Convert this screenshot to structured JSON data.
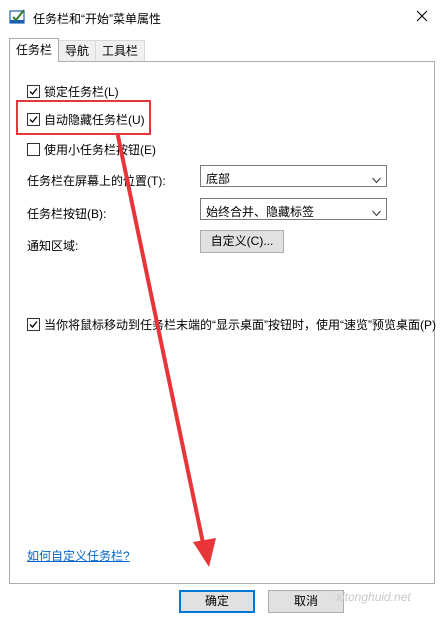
{
  "window": {
    "title": "任务栏和“开始”菜单属性"
  },
  "tabs": [
    {
      "label": "任务栏",
      "active": true
    },
    {
      "label": "导航",
      "active": false
    },
    {
      "label": "工具栏",
      "active": false
    }
  ],
  "checkboxes": {
    "lock": {
      "label": "锁定任务栏(L)",
      "checked": true
    },
    "autohide": {
      "label": "自动隐藏任务栏(U)",
      "checked": true
    },
    "small_buttons": {
      "label": "使用小任务栏按钮(E)",
      "checked": false
    },
    "peek": {
      "label": "当你将鼠标移动到任务栏末端的“显示桌面”按钮时，使用“速览”预览桌面(P)",
      "checked": true
    }
  },
  "fields": {
    "position_label": "任务栏在屏幕上的位置(T):",
    "position_value": "底部",
    "buttons_label": "任务栏按钮(B):",
    "buttons_value": "始终合并、隐藏标签",
    "notify_label": "通知区域:",
    "customize_button": "自定义(C)..."
  },
  "help_link": "如何自定义任务栏?",
  "buttons": {
    "ok": "确定",
    "cancel": "取消"
  },
  "watermark": "·xitonghuid.net",
  "colors": {
    "annotation": "#e8353a",
    "link": "#0066cc",
    "primary_border": "#0078d7"
  }
}
